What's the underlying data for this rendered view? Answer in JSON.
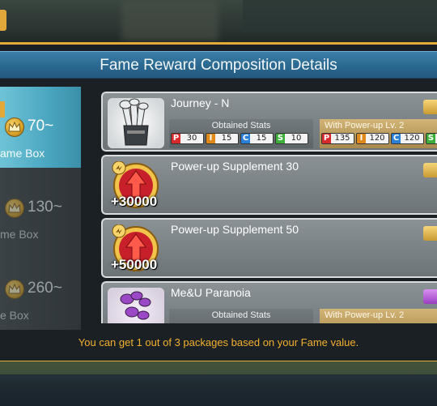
{
  "dialog": {
    "title": "Fame Reward Composition Details",
    "footer_message": "You can get 1 out of 3 packages based on your Fame value."
  },
  "tiers": [
    {
      "score": "70~",
      "label": "ame Box",
      "active": true
    },
    {
      "score": "130~",
      "label": "me Box",
      "active": false
    },
    {
      "score": "260~",
      "label": "e Box",
      "active": false
    }
  ],
  "rewards": [
    {
      "name": "Journey - N",
      "type": "club",
      "tag_color": "#e2b24a",
      "obtained_stats_label": "Obtained Stats",
      "powerup_label": "With Power-up Lv. 2",
      "stats": [
        {
          "key": "P",
          "value": "30"
        },
        {
          "key": "I",
          "value": "15"
        },
        {
          "key": "C",
          "value": "15"
        },
        {
          "key": "S",
          "value": "10"
        }
      ],
      "powerup_stats": [
        {
          "key": "P",
          "value": "135"
        },
        {
          "key": "I",
          "value": "120"
        },
        {
          "key": "C",
          "value": "120"
        },
        {
          "key": "S",
          "value": ""
        }
      ]
    },
    {
      "name": "Power-up Supplement 30",
      "type": "supplement",
      "bonus": "+30000",
      "tag_color": "#e2b24a"
    },
    {
      "name": "Power-up Supplement 50",
      "type": "supplement",
      "bonus": "+50000",
      "tag_color": "#e2b24a"
    },
    {
      "name": "Me&U Paranoia",
      "type": "club",
      "tag_color": "#b55ad8",
      "obtained_stats_label": "Obtained Stats",
      "powerup_label": "With Power-up Lv. 2"
    }
  ]
}
